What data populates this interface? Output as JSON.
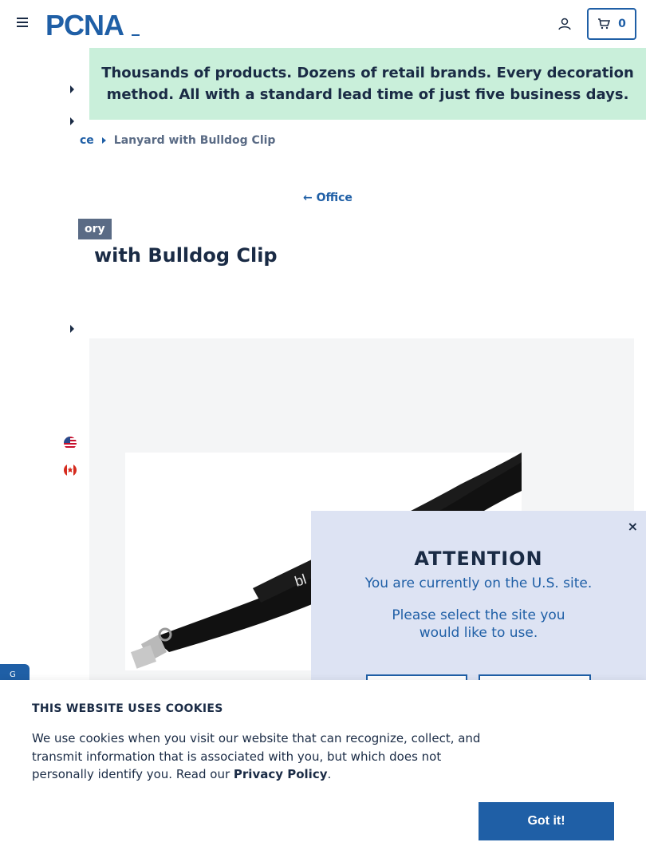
{
  "header": {
    "logo_text": "PCNA",
    "cart_count": "0"
  },
  "announcement": {
    "text": "Thousands of products. Dozens of retail brands. Every decoration method. All with a standard lead time of just five business days."
  },
  "breadcrumb": {
    "parent": "ce",
    "current": "Lanyard with Bulldog Clip"
  },
  "back_link": "Office",
  "product": {
    "badge": "ory",
    "title": "with Bulldog Clip",
    "image_text": "bl"
  },
  "feedback_tab": "G",
  "modal": {
    "close": "×",
    "heading": "ATTENTION",
    "line1": "You are currently on the U.S. site.",
    "line2": "Please select the site you would like to use."
  },
  "cookie": {
    "title": "THIS WEBSITE USES COOKIES",
    "text": "We use cookies when you visit our website that can recognize, collect, and transmit information that is associated with you, but which does not personally identify you. Read our ",
    "link": "Privacy Policy",
    "after_link": ".",
    "button": "Got it!"
  },
  "colors": {
    "brand_blue": "#1f5fa6",
    "navy": "#1a2b45",
    "announce_bg": "#c9efda",
    "modal_bg": "#dde3f3"
  }
}
